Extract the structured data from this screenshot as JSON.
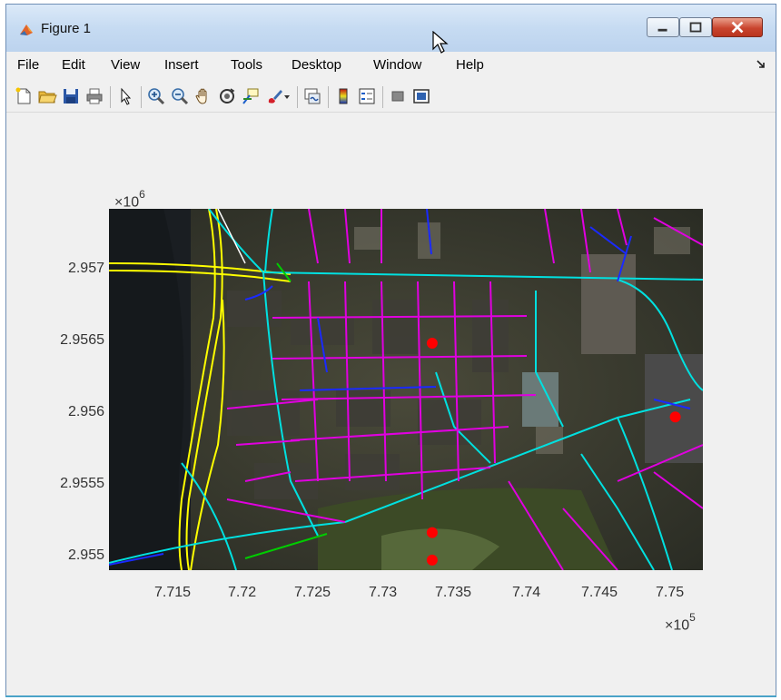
{
  "window": {
    "title": "Figure 1"
  },
  "menu": {
    "items": [
      "File",
      "Edit",
      "View",
      "Insert",
      "Tools",
      "Desktop",
      "Window",
      "Help"
    ]
  },
  "toolbar": {
    "icons": [
      "new-figure-icon",
      "open-file-icon",
      "save-icon",
      "print-icon",
      "pointer-icon",
      "zoom-in-icon",
      "zoom-out-icon",
      "pan-icon",
      "rotate-3d-icon",
      "data-cursor-icon",
      "brush-icon",
      "link-plot-icon",
      "colorbar-icon",
      "legend-icon",
      "hide-plot-tools-icon",
      "show-plot-tools-icon"
    ]
  },
  "axes": {
    "x_exponent_base": "×10",
    "x_exponent_power": "5",
    "y_exponent_base": "×10",
    "y_exponent_power": "6",
    "x_ticks": [
      "7.715",
      "7.72",
      "7.725",
      "7.73",
      "7.735",
      "7.74",
      "7.745",
      "7.75"
    ],
    "y_ticks": [
      "2.957",
      "2.9565",
      "2.956",
      "2.9555",
      "2.955"
    ]
  },
  "chart_data": {
    "type": "scatter",
    "title": "",
    "xlabel": "",
    "ylabel": "",
    "x_ticks": [
      771500,
      772000,
      772500,
      773000,
      773500,
      774000,
      774500,
      775000
    ],
    "y_ticks": [
      2957000,
      2956500,
      2956000,
      2955500,
      2955000
    ],
    "xlim": [
      771100,
      775400
    ],
    "ylim": [
      2954900,
      2957400
    ],
    "grid": false,
    "series": [
      {
        "color": "#ff0000",
        "x": [
          773440,
          773440,
          773440,
          775200
        ],
        "y": [
          2956470,
          2955160,
          2954970,
          2955960
        ]
      }
    ],
    "background": "aerial basemap image with road network overlay",
    "road_colors": {
      "primary": "#ffff00",
      "secondary": "#00e5e5",
      "tertiary": "#e000e0",
      "minor": "#1a2aff",
      "path": "#00cc00"
    }
  }
}
